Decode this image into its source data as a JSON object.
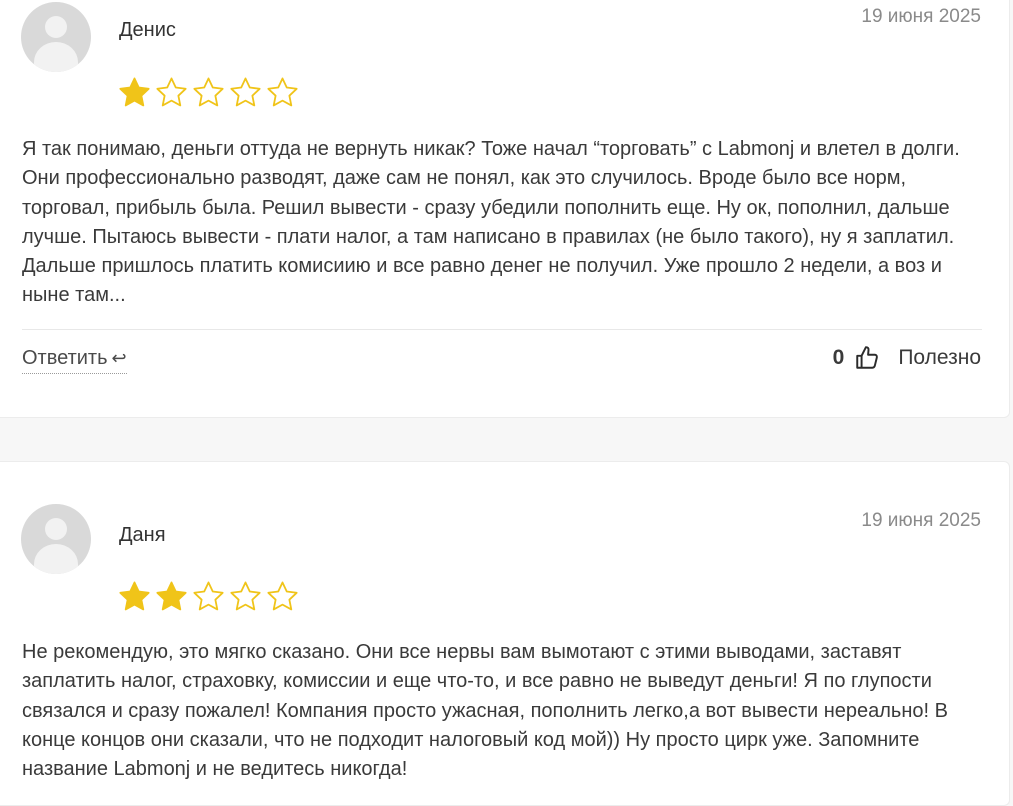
{
  "colors": {
    "star": "#f0c419",
    "accent": "#333333"
  },
  "reviews": [
    {
      "author": "Денис",
      "date": "19 июня 2025",
      "rating": 1,
      "text": "Я так понимаю, деньги оттуда не вернуть никак? Тоже начал “торговать” с Labmonj и влетел в долги. Они профессионально разводят, даже сам не понял, как это случилось. Вроде было все норм, торговал, прибыль была. Решил вывести - сразу убедили пополнить еще. Ну ок, пополнил, дальше лучше. Пытаюсь вывести - плати налог, а там написано в правилах (не было такого), ну я заплатил. Дальше пришлось платить комисиию и все равно денег не получил. Уже прошло 2 недели, а воз и ныне там...",
      "reply_label": "Ответить",
      "helpful_count": "0",
      "helpful_label": "Полезно"
    },
    {
      "author": "Даня",
      "date": "19 июня 2025",
      "rating": 2,
      "text": "Не рекомендую, это мягко сказано. Они все нервы вам вымотают с этими выводами, заставят заплатить налог, страховку, комиссии и еще что-то, и все равно не выведут деньги! Я по глупости связался и сразу пожалел! Компания просто ужасная, пополнить легко,а вот вывести нереально! В конце концов они сказали, что не подходит налоговый код мой)) Ну просто цирк уже. Запомните название Labmonj и не ведитесь никогда!"
    }
  ]
}
